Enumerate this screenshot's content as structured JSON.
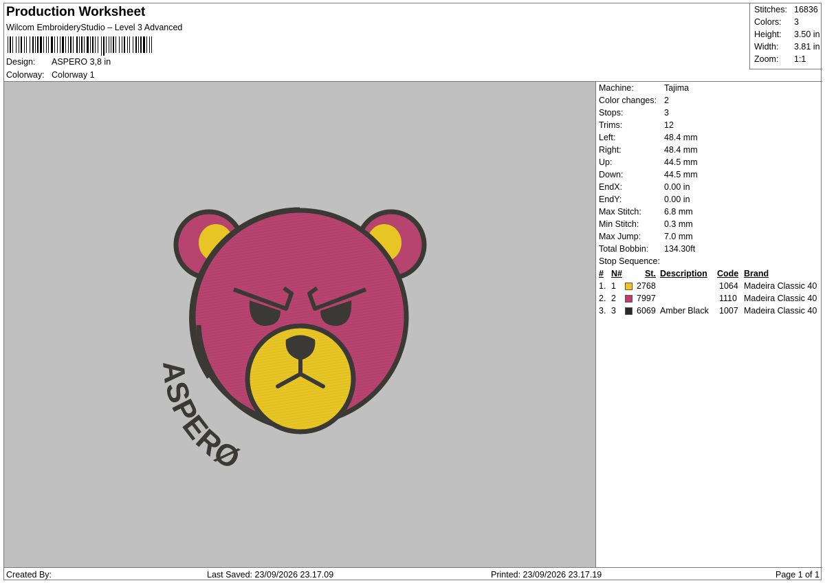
{
  "header": {
    "title": "Production Worksheet",
    "subtitle": "Wilcom EmbroideryStudio – Level 3 Advanced",
    "design_label": "Design:",
    "design_value": "ASPERO 3,8 in",
    "colorway_label": "Colorway:",
    "colorway_value": "Colorway 1"
  },
  "summary": [
    {
      "label": "Stitches:",
      "value": "16836"
    },
    {
      "label": "Colors:",
      "value": "3"
    },
    {
      "label": "Height:",
      "value": "3.50 in"
    },
    {
      "label": "Width:",
      "value": "3.81 in"
    },
    {
      "label": "Zoom:",
      "value": "1:1"
    }
  ],
  "machine_info": [
    {
      "label": "Machine:",
      "value": "Tajima"
    },
    {
      "label": "Color changes:",
      "value": "2"
    },
    {
      "label": "Stops:",
      "value": "3"
    },
    {
      "label": "Trims:",
      "value": "12"
    },
    {
      "label": "Left:",
      "value": "48.4 mm"
    },
    {
      "label": "Right:",
      "value": "48.4 mm"
    },
    {
      "label": "Up:",
      "value": "44.5 mm"
    },
    {
      "label": "Down:",
      "value": "44.5 mm"
    },
    {
      "label": "EndX:",
      "value": "0.00 in"
    },
    {
      "label": "EndY:",
      "value": "0.00 in"
    },
    {
      "label": "Max Stitch:",
      "value": "6.8 mm"
    },
    {
      "label": "Min Stitch:",
      "value": "0.3 mm"
    },
    {
      "label": "Max Jump:",
      "value": "7.0 mm"
    },
    {
      "label": "Total Bobbin:",
      "value": "134.30ft"
    }
  ],
  "stop_sequence": {
    "label": "Stop Sequence:",
    "columns": [
      "#",
      "N#",
      "St.",
      "Description",
      "Code",
      "Brand"
    ],
    "rows": [
      {
        "num": "1.",
        "n": "1",
        "color": "#f3c220",
        "stitches": "2768",
        "description": "",
        "code": "1064",
        "brand": "Madeira Classic 40"
      },
      {
        "num": "2.",
        "n": "2",
        "color": "#c43a6e",
        "stitches": "7997",
        "description": "",
        "code": "1110",
        "brand": "Madeira Classic 40"
      },
      {
        "num": "3.",
        "n": "3",
        "color": "#2a2a2a",
        "stitches": "6069",
        "description": "Amber Black",
        "code": "1007",
        "brand": "Madeira Classic 40"
      }
    ]
  },
  "design_text": "ASPERØ",
  "colors": {
    "background": "#c0c0c0",
    "pink": "#b7436f",
    "yellow": "#e6c524",
    "outline": "#3a3935"
  },
  "footer": {
    "created_by": "Created By:",
    "last_saved": "Last Saved: 23/09/2026 23.17.09",
    "printed": "Printed: 23/09/2026 23.17.19",
    "page": "Page 1 of 1"
  }
}
